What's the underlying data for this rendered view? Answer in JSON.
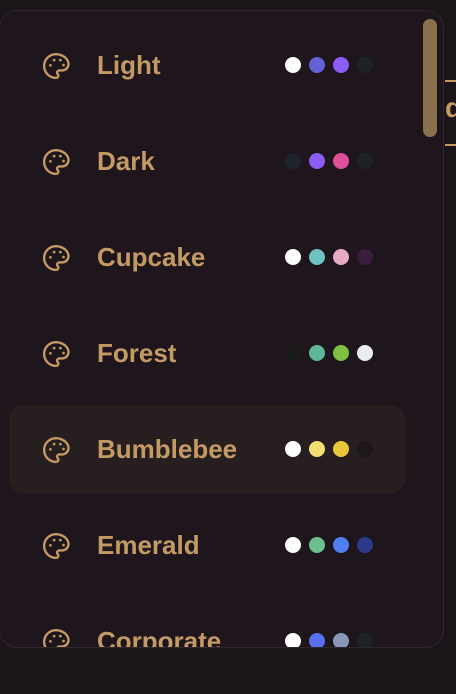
{
  "background": {
    "peek_text": "d"
  },
  "themes": [
    {
      "label": "Light",
      "icon": "palette-icon",
      "swatches": [
        "#ffffff",
        "#6062d6",
        "#8b5cf6",
        "#1e2228"
      ],
      "active": false
    },
    {
      "label": "Dark",
      "icon": "palette-icon",
      "swatches": [
        "#1f242c",
        "#8b5cf6",
        "#e0509a",
        "#1e2228"
      ],
      "active": false
    },
    {
      "label": "Cupcake",
      "icon": "palette-icon",
      "swatches": [
        "#ffffff",
        "#6ec3c1",
        "#e7a9c4",
        "#3a1d3d"
      ],
      "active": false
    },
    {
      "label": "Forest",
      "icon": "palette-icon",
      "swatches": [
        "#1c1b1b",
        "#5fb79a",
        "#7ec140",
        "#eaecef"
      ],
      "active": false
    },
    {
      "label": "Bumblebee",
      "icon": "palette-icon",
      "swatches": [
        "#ffffff",
        "#f5de72",
        "#e9c73a",
        "#1d1717"
      ],
      "active": true
    },
    {
      "label": "Emerald",
      "icon": "palette-icon",
      "swatches": [
        "#ffffff",
        "#6cc08b",
        "#4f7ff0",
        "#2b3a8a"
      ],
      "active": false
    },
    {
      "label": "Corporate",
      "icon": "palette-icon",
      "swatches": [
        "#ffffff",
        "#5a6ff0",
        "#8a97b8",
        "#1e2228"
      ],
      "active": false
    }
  ],
  "colors": {
    "accent": "#c49a64",
    "panel": "#1e161c",
    "active_row": "#261e1f"
  }
}
